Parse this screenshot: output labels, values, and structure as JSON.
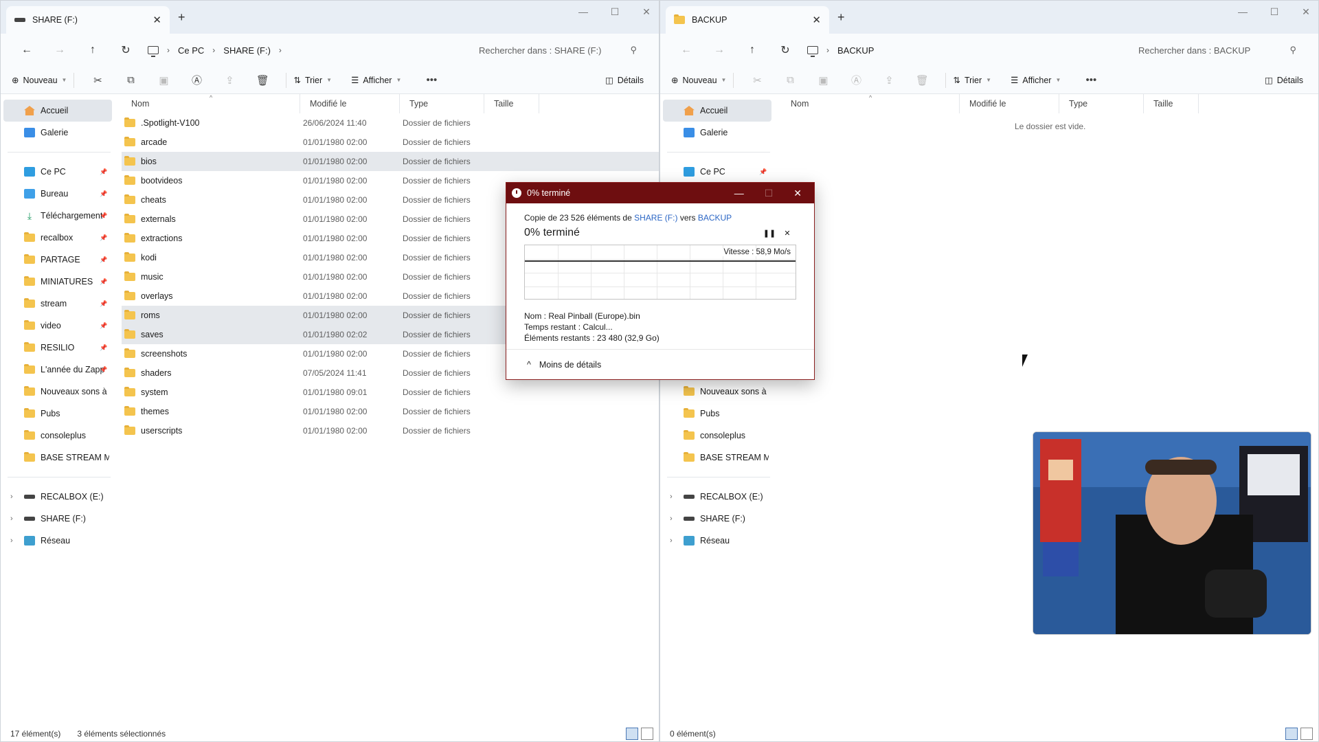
{
  "left": {
    "tab_title": "SHARE (F:)",
    "breadcrumb": [
      "Ce PC",
      "SHARE (F:)"
    ],
    "search_placeholder": "Rechercher dans : SHARE (F:)",
    "toolbar": {
      "new": "Nouveau",
      "sort": "Trier",
      "view": "Afficher",
      "details": "Détails"
    },
    "sidebar": {
      "quick": [
        "Accueil",
        "Galerie"
      ],
      "pinned": [
        "Ce PC",
        "Bureau",
        "Téléchargement",
        "recalbox",
        "PARTAGE",
        "MINIATURES",
        "stream",
        "video",
        "RESILIO",
        "L'année du Zapp"
      ],
      "unpinned": [
        "Nouveaux sons à er",
        "Pubs",
        "consoleplus",
        "BASE STREAM MUS"
      ],
      "drives": [
        "RECALBOX (E:)",
        "SHARE (F:)",
        "Réseau"
      ]
    },
    "columns": [
      "Nom",
      "Modifié le",
      "Type",
      "Taille"
    ],
    "files": [
      {
        "name": ".Spotlight-V100",
        "date": "26/06/2024 11:40",
        "type": "Dossier de fichiers"
      },
      {
        "name": "arcade",
        "date": "01/01/1980 02:00",
        "type": "Dossier de fichiers"
      },
      {
        "name": "bios",
        "date": "01/01/1980 02:00",
        "type": "Dossier de fichiers"
      },
      {
        "name": "bootvideos",
        "date": "01/01/1980 02:00",
        "type": "Dossier de fichiers"
      },
      {
        "name": "cheats",
        "date": "01/01/1980 02:00",
        "type": "Dossier de fichiers"
      },
      {
        "name": "externals",
        "date": "01/01/1980 02:00",
        "type": "Dossier de fichiers"
      },
      {
        "name": "extractions",
        "date": "01/01/1980 02:00",
        "type": "Dossier de fichiers"
      },
      {
        "name": "kodi",
        "date": "01/01/1980 02:00",
        "type": "Dossier de fichiers"
      },
      {
        "name": "music",
        "date": "01/01/1980 02:00",
        "type": "Dossier de fichiers"
      },
      {
        "name": "overlays",
        "date": "01/01/1980 02:00",
        "type": "Dossier de fichiers"
      },
      {
        "name": "roms",
        "date": "01/01/1980 02:00",
        "type": "Dossier de fichiers"
      },
      {
        "name": "saves",
        "date": "01/01/1980 02:02",
        "type": "Dossier de fichiers"
      },
      {
        "name": "screenshots",
        "date": "01/01/1980 02:00",
        "type": "Dossier de fichiers"
      },
      {
        "name": "shaders",
        "date": "07/05/2024 11:41",
        "type": "Dossier de fichiers"
      },
      {
        "name": "system",
        "date": "01/01/1980 09:01",
        "type": "Dossier de fichiers"
      },
      {
        "name": "themes",
        "date": "01/01/1980 02:00",
        "type": "Dossier de fichiers"
      },
      {
        "name": "userscripts",
        "date": "01/01/1980 02:00",
        "type": "Dossier de fichiers"
      }
    ],
    "selected_rows": [
      2,
      10,
      11
    ],
    "status_count": "17 élément(s)",
    "status_selected": "3 éléments sélectionnés"
  },
  "right": {
    "tab_title": "BACKUP",
    "breadcrumb": [
      "BACKUP"
    ],
    "search_placeholder": "Rechercher dans : BACKUP",
    "toolbar": {
      "new": "Nouveau",
      "sort": "Trier",
      "view": "Afficher",
      "details": "Détails"
    },
    "sidebar": {
      "quick": [
        "Accueil",
        "Galerie"
      ],
      "pinned": [
        "Ce PC"
      ],
      "unpinned": [
        "Nouveaux sons à er",
        "Pubs",
        "consoleplus",
        "BASE STREAM MUS"
      ],
      "drives": [
        "RECALBOX (E:)",
        "SHARE (F:)",
        "Réseau"
      ]
    },
    "columns": [
      "Nom",
      "Modifié le",
      "Type",
      "Taille"
    ],
    "empty_text": "Le dossier est vide.",
    "status_count": "0 élément(s)"
  },
  "dialog": {
    "title": "0% terminé",
    "copy_prefix": "Copie de 23 526 éléments de",
    "copy_source": "SHARE (F:)",
    "copy_mid": "vers",
    "copy_dest": "BACKUP",
    "progress_text": "0% terminé",
    "speed": "Vitesse : 58,9 Mo/s",
    "name_line": "Nom :  Real Pinball (Europe).bin",
    "time_line": "Temps restant :  Calcul...",
    "remaining_line": "Éléments restants :  23 480 (32,9 Go)",
    "less_details": "Moins de détails",
    "progress": 0
  },
  "colors": {
    "dialog_title": "#6e0e10",
    "link": "#2b66c5",
    "folder": "#f4c44e"
  }
}
